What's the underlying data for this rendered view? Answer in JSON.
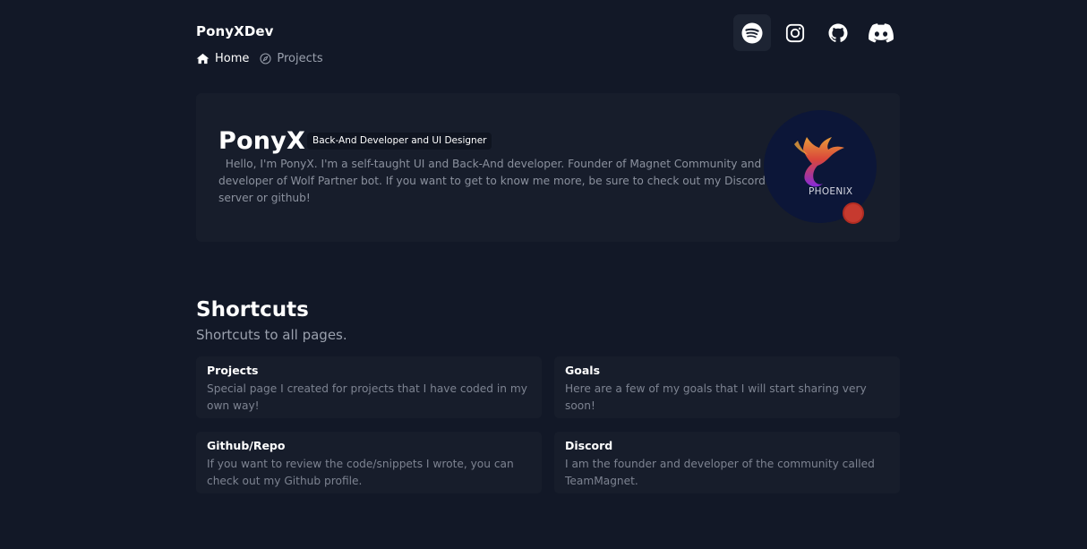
{
  "header": {
    "brand": "PonyXDev",
    "nav": [
      {
        "label": "Home",
        "icon": "home-icon",
        "active": true
      },
      {
        "label": "Projects",
        "icon": "compass-icon",
        "active": false
      }
    ],
    "social": [
      {
        "icon": "spotify-icon"
      },
      {
        "icon": "instagram-icon"
      },
      {
        "icon": "github-icon"
      },
      {
        "icon": "discord-icon"
      }
    ]
  },
  "hero": {
    "name": "PonyX",
    "badge": "Back-And Developer and UI Designer",
    "bio": "Hello, I'm PonyX. I'm a self-taught UI and Back-And developer. Founder of Magnet Community and developer of Wolf Partner bot. If you want to get to know me more, be sure to check out my Discord server or github!",
    "avatar_text": "PHOENIX",
    "status_color": "#c63a2f"
  },
  "shortcuts": {
    "title": "Shortcuts",
    "subtitle": "Shortcuts to all pages.",
    "items": [
      {
        "title": "Projects",
        "desc": "Special page I created for projects that I have coded in my own way!"
      },
      {
        "title": "Goals",
        "desc": "Here are a few of my goals that I will start sharing very soon!"
      },
      {
        "title": "Github/Repo",
        "desc": "If you want to review the code/snippets I wrote, you can check out my Github profile."
      },
      {
        "title": "Discord",
        "desc": "I am the founder and developer of the community called TeamMagnet."
      }
    ]
  },
  "colors": {
    "background": "#121827",
    "card": "#171d2b",
    "muted_text": "#8b919e"
  }
}
